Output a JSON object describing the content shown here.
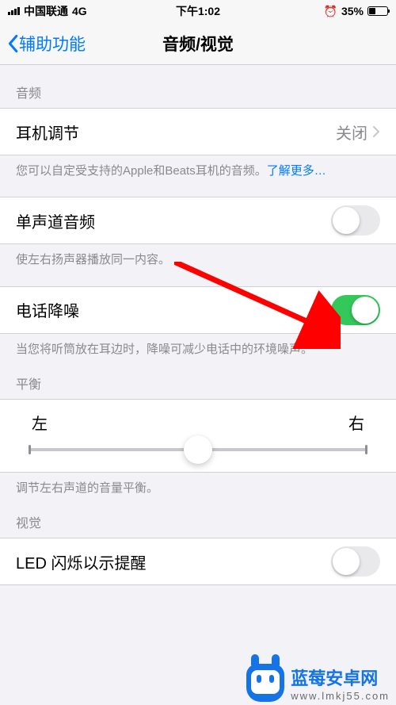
{
  "status": {
    "carrier": "中国联通",
    "network": "4G",
    "time": "下午1:02",
    "battery_pct": "35%"
  },
  "nav": {
    "back_label": "辅助功能",
    "title": "音频/视觉"
  },
  "audio": {
    "section_title": "音频",
    "headphone_adjust": {
      "label": "耳机调节",
      "value": "关闭"
    },
    "headphone_footer_text": "您可以自定受支持的Apple和Beats耳机的音频。",
    "headphone_footer_link": "了解更多…",
    "mono": {
      "label": "单声道音频",
      "on": false
    },
    "mono_footer": "使左右扬声器播放同一内容。",
    "noise": {
      "label": "电话降噪",
      "on": true
    },
    "noise_footer": "当您将听筒放在耳边时，降噪可减少电话中的环境噪声。",
    "balance": {
      "caption": "平衡",
      "left": "左",
      "right": "右",
      "footer": "调节左右声道的音量平衡。"
    }
  },
  "visual": {
    "section_title": "视觉",
    "led": {
      "label": "LED 闪烁以示提醒",
      "on": false
    }
  },
  "watermark": {
    "title": "蓝莓安卓网",
    "url": "www.lmkj55.com"
  }
}
